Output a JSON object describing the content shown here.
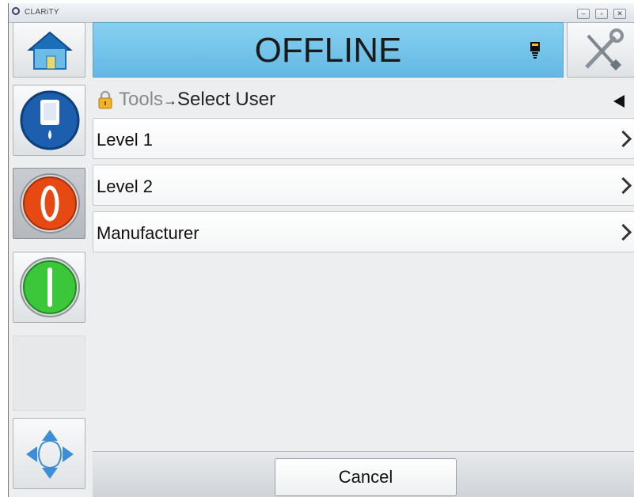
{
  "window": {
    "title": "CLARiTY",
    "controls": [
      "minimize-icon",
      "maximize-icon",
      "close-icon"
    ]
  },
  "header": {
    "home_icon": "home-icon",
    "status": "OFFLINE",
    "status_icon": "printhead-icon",
    "tools_icon": "tools-icon"
  },
  "sidebar": {
    "items": [
      {
        "icon": "ink-cartridge-icon"
      },
      {
        "icon": "stop-icon"
      },
      {
        "icon": "start-icon"
      }
    ],
    "nav_icon": "navigate-arrows-icon"
  },
  "breadcrumb": {
    "lock_icon": "padlock-icon",
    "parent": "Tools",
    "separator": "→",
    "current": "Select User",
    "back_icon": "back-arrow-icon"
  },
  "list": {
    "items": [
      {
        "label": "Level 1"
      },
      {
        "label": "Level 2"
      },
      {
        "label": "Manufacturer"
      }
    ]
  },
  "footer": {
    "cancel_label": "Cancel"
  },
  "colors": {
    "status_bar": "#6cc0ea",
    "stop": "#e64a12",
    "start": "#3cc63a",
    "ink": "#1d5fae"
  }
}
